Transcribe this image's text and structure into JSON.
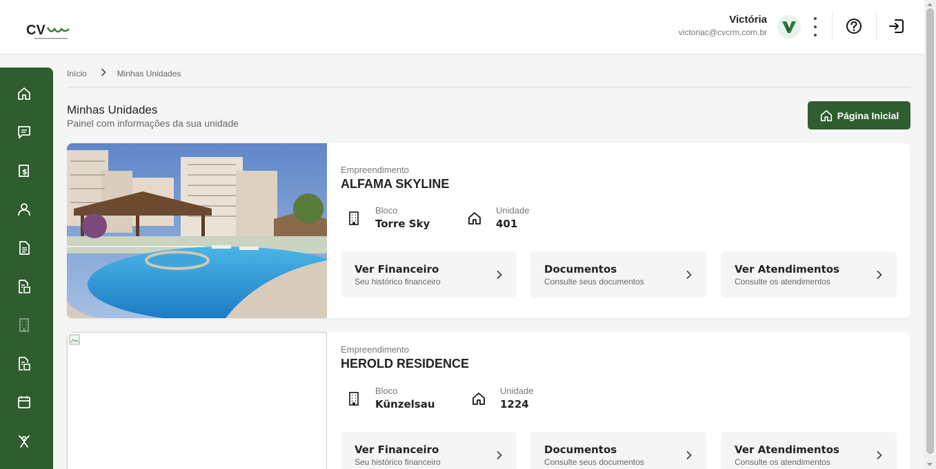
{
  "header": {
    "logo_alt": "CVCRM",
    "user_name": "Victória",
    "user_email": "victoriac@cvcrm.com.br",
    "avatar_letter": "V"
  },
  "sidebar": {
    "items": [
      {
        "icon": "home-icon"
      },
      {
        "icon": "chat-icon"
      },
      {
        "icon": "financial-icon"
      },
      {
        "icon": "user-icon"
      },
      {
        "icon": "document-icon"
      },
      {
        "icon": "document-search-icon"
      },
      {
        "icon": "building-icon"
      },
      {
        "icon": "document-search-icon-2"
      },
      {
        "icon": "calendar-icon"
      },
      {
        "icon": "tools-icon"
      }
    ]
  },
  "breadcrumb": {
    "home": "Início",
    "current": "Minhas Unidades"
  },
  "page": {
    "title": "Minhas Unidades",
    "subtitle": "Painel com informações da sua unidade",
    "home_button": "Página Inicial"
  },
  "units": [
    {
      "emp_label": "Empreendimento",
      "emp_name": "ALFAMA SKYLINE",
      "bloco_label": "Bloco",
      "bloco_value": "Torre Sky",
      "unidade_label": "Unidade",
      "unidade_value": "401",
      "actions": [
        {
          "title": "Ver Financeiro",
          "sub": "Seu histórico financeiro"
        },
        {
          "title": "Documentos",
          "sub": "Consulte seus documentos"
        },
        {
          "title": "Ver Atendimentos",
          "sub": "Consulte os atendimentos"
        }
      ]
    },
    {
      "emp_label": "Empreendimento",
      "emp_name": "HEROLD RESIDENCE",
      "bloco_label": "Bloco",
      "bloco_value": "Künzelsau",
      "unidade_label": "Unidade",
      "unidade_value": "1224",
      "actions": [
        {
          "title": "Ver Financeiro",
          "sub": "Seu histórico financeiro"
        },
        {
          "title": "Documentos",
          "sub": "Consulte seus documentos"
        },
        {
          "title": "Ver Atendimentos",
          "sub": "Consulte os atendimentos"
        }
      ]
    }
  ],
  "colors": {
    "brand_green": "#2f5d2f",
    "background": "#f5f5f5"
  }
}
